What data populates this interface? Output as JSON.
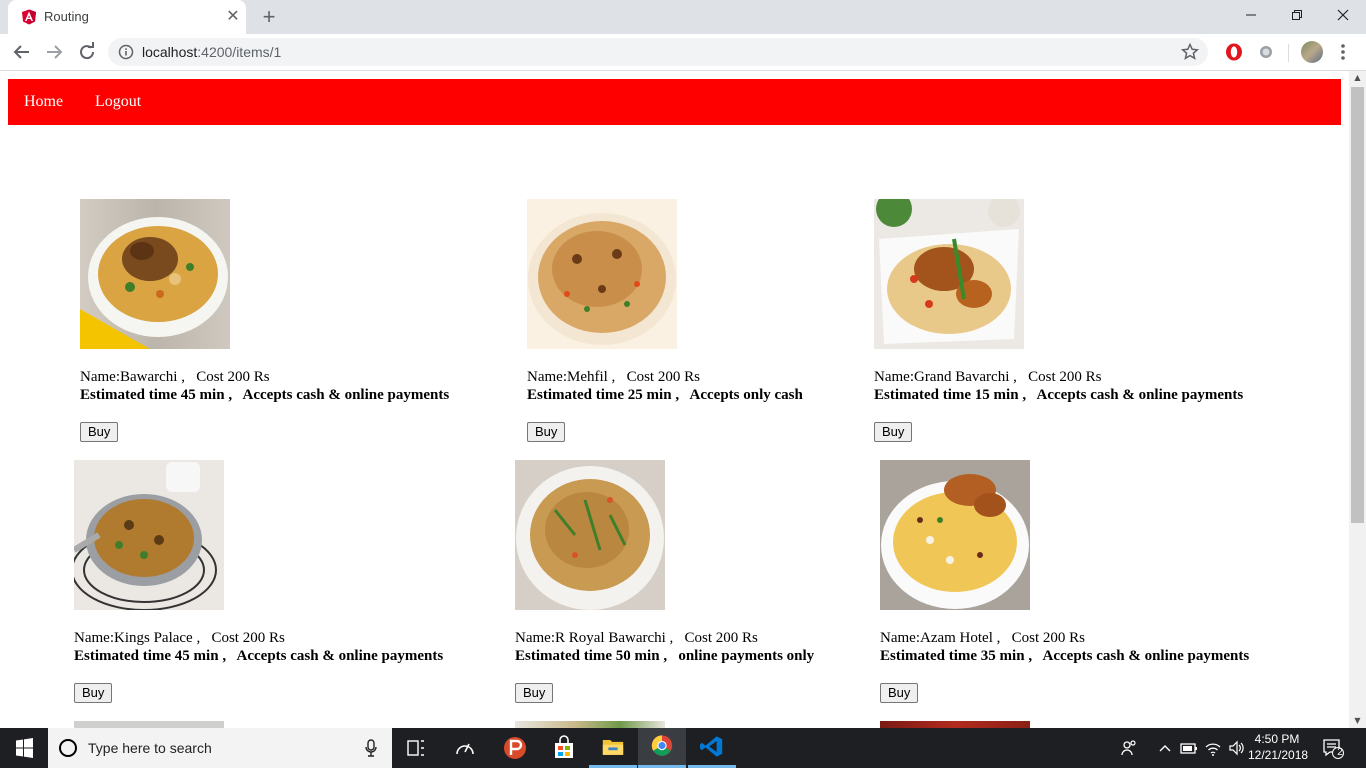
{
  "browser": {
    "tab_title": "Routing",
    "url_host": "localhost",
    "url_path": ":4200/items/1"
  },
  "nav": {
    "home": "Home",
    "logout": "Logout"
  },
  "items": [
    {
      "name": "Name:Bawarchi ,",
      "cost": "Cost 200 Rs",
      "time": "Estimated time 45 min ,",
      "payment": "Accepts cash & online payments",
      "buy": "Buy"
    },
    {
      "name": "Name:Mehfil ,",
      "cost": "Cost 200 Rs",
      "time": "Estimated time 25 min ,",
      "payment": "Accepts only cash",
      "buy": "Buy"
    },
    {
      "name": "Name:Grand Bavarchi ,",
      "cost": "Cost 200 Rs",
      "time": "Estimated time 15 min ,",
      "payment": "Accepts cash & online payments",
      "buy": "Buy"
    },
    {
      "name": "Name:Kings Palace ,",
      "cost": "Cost 200 Rs",
      "time": "Estimated time 45 min ,",
      "payment": "Accepts cash & online payments",
      "buy": "Buy"
    },
    {
      "name": "Name:R Royal Bawarchi ,",
      "cost": "Cost 200 Rs",
      "time": "Estimated time 50 min ,",
      "payment": "online payments only",
      "buy": "Buy"
    },
    {
      "name": "Name:Azam Hotel ,",
      "cost": "Cost 200 Rs",
      "time": "Estimated time 35 min ,",
      "payment": "Accepts cash & online payments",
      "buy": "Buy"
    }
  ],
  "taskbar": {
    "search_placeholder": "Type here to search",
    "time": "4:50 PM",
    "date": "12/21/2018",
    "notification_count": "2"
  },
  "colors": {
    "navbar": "#ff0000",
    "taskbar": "#1d1f22"
  },
  "icons": [
    "angular-icon",
    "close-icon",
    "plus-icon",
    "back-arrow-icon",
    "forward-arrow-icon",
    "reload-icon",
    "info-icon",
    "star-icon",
    "opera-icon",
    "extension-icon",
    "avatar",
    "kebab-menu-icon",
    "windows-start-icon",
    "search-icon",
    "microphone-icon",
    "task-view-icon",
    "speedometer-icon",
    "app-p-icon",
    "store-icon",
    "file-explorer-icon",
    "chrome-icon",
    "vscode-icon",
    "people-icon",
    "chevron-up-icon",
    "battery-icon",
    "wifi-icon",
    "volume-icon",
    "notification-icon"
  ]
}
